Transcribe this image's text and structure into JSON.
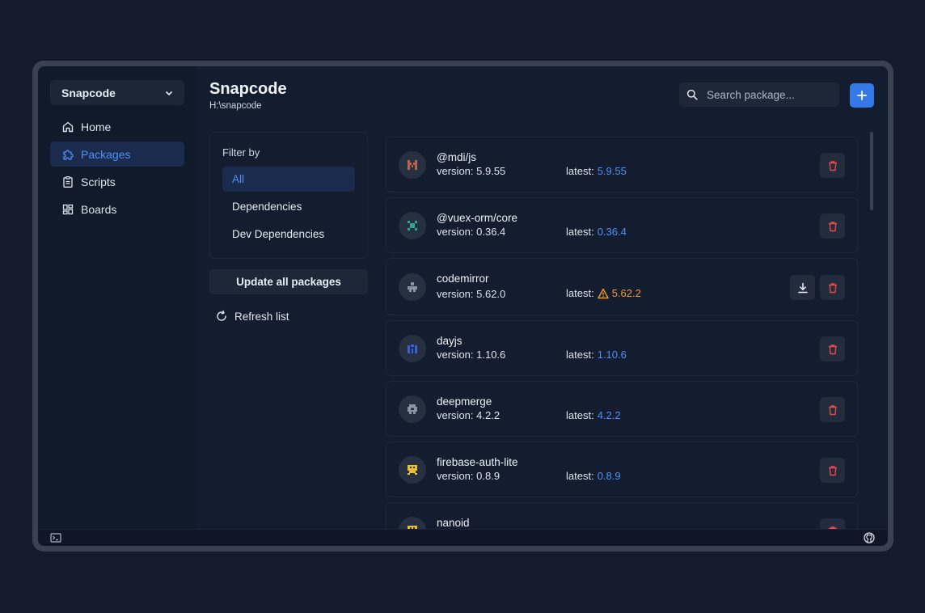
{
  "sidebar": {
    "project": "Snapcode",
    "items": [
      {
        "label": "Home",
        "icon": "home-icon"
      },
      {
        "label": "Packages",
        "icon": "puzzle-icon",
        "active": true
      },
      {
        "label": "Scripts",
        "icon": "clipboard-icon"
      },
      {
        "label": "Boards",
        "icon": "grid-icon"
      }
    ]
  },
  "header": {
    "title": "Snapcode",
    "path": "H:\\snapcode",
    "search_placeholder": "Search package..."
  },
  "filter": {
    "title": "Filter by",
    "options": [
      {
        "label": "All",
        "active": true
      },
      {
        "label": "Dependencies"
      },
      {
        "label": "Dev Dependencies"
      }
    ],
    "update_label": "Update all packages",
    "refresh_label": "Refresh list"
  },
  "packages": [
    {
      "name": "@mdi/js",
      "version": "version: 5.9.55",
      "latest_label": "latest:",
      "latest": "5.9.55",
      "outdated": false,
      "icon_color": "#b5654b"
    },
    {
      "name": "@vuex-orm/core",
      "version": "version: 0.36.4",
      "latest_label": "latest:",
      "latest": "0.36.4",
      "outdated": false,
      "icon_color": "#2fa58a"
    },
    {
      "name": "codemirror",
      "version": "version: 5.62.0",
      "latest_label": "latest:",
      "latest": "5.62.2",
      "outdated": true,
      "icon_color": "#8b93a1"
    },
    {
      "name": "dayjs",
      "version": "version: 1.10.6",
      "latest_label": "latest:",
      "latest": "1.10.6",
      "outdated": false,
      "icon_color": "#3f5fd8"
    },
    {
      "name": "deepmerge",
      "version": "version: 4.2.2",
      "latest_label": "latest:",
      "latest": "4.2.2",
      "outdated": false,
      "icon_color": "#8b93a1"
    },
    {
      "name": "firebase-auth-lite",
      "version": "version: 0.8.9",
      "latest_label": "latest:",
      "latest": "0.8.9",
      "outdated": false,
      "icon_color": "#e6c12c"
    },
    {
      "name": "nanoid",
      "version": "",
      "latest_label": "",
      "latest": "",
      "outdated": false,
      "icon_color": "#e6c12c"
    }
  ],
  "colors": {
    "accent": "#3578e8",
    "delete": "#e5484d",
    "warning": "#f39a2b"
  }
}
